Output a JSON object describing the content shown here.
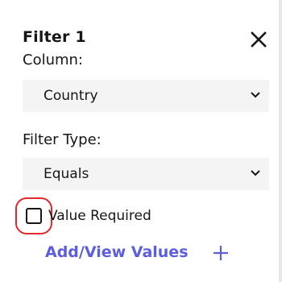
{
  "filter": {
    "title": "Filter 1",
    "close_icon": "close-icon"
  },
  "column": {
    "label": "Column:",
    "selected": "Country",
    "icon": "chevron-down-icon"
  },
  "filter_type": {
    "label": "Filter Type:",
    "selected": "Equals",
    "icon": "chevron-down-icon"
  },
  "value_required": {
    "label": "Value Required",
    "checked": false
  },
  "add_values": {
    "label": "Add/View Values",
    "icon": "plus-icon",
    "color": "#5b5fdb"
  },
  "colors": {
    "highlight_ring": "#e12b2b",
    "select_background": "#f4f4f4",
    "text": "#161616"
  }
}
